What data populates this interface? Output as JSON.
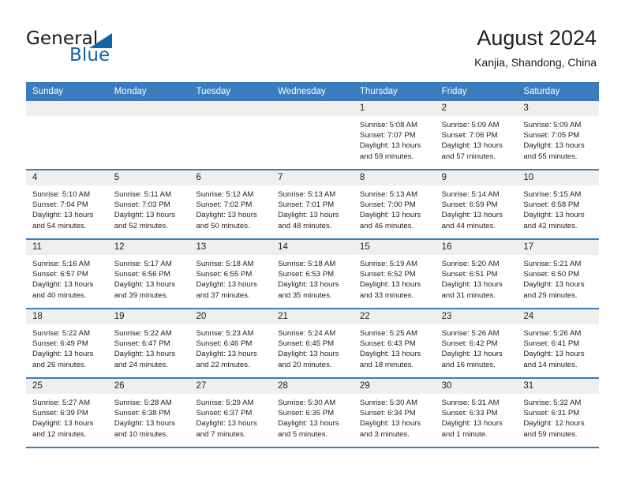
{
  "logo": {
    "general_text": "General",
    "blue_text": "Blue",
    "triangle_color": "#1464aa"
  },
  "header": {
    "title": "August 2024",
    "subtitle": "Kanjia, Shandong, China"
  },
  "theme": {
    "header_blue": "#3a7cbe",
    "day_band_gray": "#efefef",
    "text_dark": "#222222"
  },
  "weekdays": [
    "Sunday",
    "Monday",
    "Tuesday",
    "Wednesday",
    "Thursday",
    "Friday",
    "Saturday"
  ],
  "weeks": [
    {
      "days": [
        {
          "number": "",
          "sunrise": "",
          "sunset": "",
          "daylight_line1": "",
          "daylight_line2": "",
          "empty": true
        },
        {
          "number": "",
          "sunrise": "",
          "sunset": "",
          "daylight_line1": "",
          "daylight_line2": "",
          "empty": true
        },
        {
          "number": "",
          "sunrise": "",
          "sunset": "",
          "daylight_line1": "",
          "daylight_line2": "",
          "empty": true
        },
        {
          "number": "",
          "sunrise": "",
          "sunset": "",
          "daylight_line1": "",
          "daylight_line2": "",
          "empty": true
        },
        {
          "number": "1",
          "sunrise": "Sunrise: 5:08 AM",
          "sunset": "Sunset: 7:07 PM",
          "daylight_line1": "Daylight: 13 hours",
          "daylight_line2": "and 59 minutes.",
          "empty": false
        },
        {
          "number": "2",
          "sunrise": "Sunrise: 5:09 AM",
          "sunset": "Sunset: 7:06 PM",
          "daylight_line1": "Daylight: 13 hours",
          "daylight_line2": "and 57 minutes.",
          "empty": false
        },
        {
          "number": "3",
          "sunrise": "Sunrise: 5:09 AM",
          "sunset": "Sunset: 7:05 PM",
          "daylight_line1": "Daylight: 13 hours",
          "daylight_line2": "and 55 minutes.",
          "empty": false
        }
      ]
    },
    {
      "days": [
        {
          "number": "4",
          "sunrise": "Sunrise: 5:10 AM",
          "sunset": "Sunset: 7:04 PM",
          "daylight_line1": "Daylight: 13 hours",
          "daylight_line2": "and 54 minutes.",
          "empty": false
        },
        {
          "number": "5",
          "sunrise": "Sunrise: 5:11 AM",
          "sunset": "Sunset: 7:03 PM",
          "daylight_line1": "Daylight: 13 hours",
          "daylight_line2": "and 52 minutes.",
          "empty": false
        },
        {
          "number": "6",
          "sunrise": "Sunrise: 5:12 AM",
          "sunset": "Sunset: 7:02 PM",
          "daylight_line1": "Daylight: 13 hours",
          "daylight_line2": "and 50 minutes.",
          "empty": false
        },
        {
          "number": "7",
          "sunrise": "Sunrise: 5:13 AM",
          "sunset": "Sunset: 7:01 PM",
          "daylight_line1": "Daylight: 13 hours",
          "daylight_line2": "and 48 minutes.",
          "empty": false
        },
        {
          "number": "8",
          "sunrise": "Sunrise: 5:13 AM",
          "sunset": "Sunset: 7:00 PM",
          "daylight_line1": "Daylight: 13 hours",
          "daylight_line2": "and 46 minutes.",
          "empty": false
        },
        {
          "number": "9",
          "sunrise": "Sunrise: 5:14 AM",
          "sunset": "Sunset: 6:59 PM",
          "daylight_line1": "Daylight: 13 hours",
          "daylight_line2": "and 44 minutes.",
          "empty": false
        },
        {
          "number": "10",
          "sunrise": "Sunrise: 5:15 AM",
          "sunset": "Sunset: 6:58 PM",
          "daylight_line1": "Daylight: 13 hours",
          "daylight_line2": "and 42 minutes.",
          "empty": false
        }
      ]
    },
    {
      "days": [
        {
          "number": "11",
          "sunrise": "Sunrise: 5:16 AM",
          "sunset": "Sunset: 6:57 PM",
          "daylight_line1": "Daylight: 13 hours",
          "daylight_line2": "and 40 minutes.",
          "empty": false
        },
        {
          "number": "12",
          "sunrise": "Sunrise: 5:17 AM",
          "sunset": "Sunset: 6:56 PM",
          "daylight_line1": "Daylight: 13 hours",
          "daylight_line2": "and 39 minutes.",
          "empty": false
        },
        {
          "number": "13",
          "sunrise": "Sunrise: 5:18 AM",
          "sunset": "Sunset: 6:55 PM",
          "daylight_line1": "Daylight: 13 hours",
          "daylight_line2": "and 37 minutes.",
          "empty": false
        },
        {
          "number": "14",
          "sunrise": "Sunrise: 5:18 AM",
          "sunset": "Sunset: 6:53 PM",
          "daylight_line1": "Daylight: 13 hours",
          "daylight_line2": "and 35 minutes.",
          "empty": false
        },
        {
          "number": "15",
          "sunrise": "Sunrise: 5:19 AM",
          "sunset": "Sunset: 6:52 PM",
          "daylight_line1": "Daylight: 13 hours",
          "daylight_line2": "and 33 minutes.",
          "empty": false
        },
        {
          "number": "16",
          "sunrise": "Sunrise: 5:20 AM",
          "sunset": "Sunset: 6:51 PM",
          "daylight_line1": "Daylight: 13 hours",
          "daylight_line2": "and 31 minutes.",
          "empty": false
        },
        {
          "number": "17",
          "sunrise": "Sunrise: 5:21 AM",
          "sunset": "Sunset: 6:50 PM",
          "daylight_line1": "Daylight: 13 hours",
          "daylight_line2": "and 29 minutes.",
          "empty": false
        }
      ]
    },
    {
      "days": [
        {
          "number": "18",
          "sunrise": "Sunrise: 5:22 AM",
          "sunset": "Sunset: 6:49 PM",
          "daylight_line1": "Daylight: 13 hours",
          "daylight_line2": "and 26 minutes.",
          "empty": false
        },
        {
          "number": "19",
          "sunrise": "Sunrise: 5:22 AM",
          "sunset": "Sunset: 6:47 PM",
          "daylight_line1": "Daylight: 13 hours",
          "daylight_line2": "and 24 minutes.",
          "empty": false
        },
        {
          "number": "20",
          "sunrise": "Sunrise: 5:23 AM",
          "sunset": "Sunset: 6:46 PM",
          "daylight_line1": "Daylight: 13 hours",
          "daylight_line2": "and 22 minutes.",
          "empty": false
        },
        {
          "number": "21",
          "sunrise": "Sunrise: 5:24 AM",
          "sunset": "Sunset: 6:45 PM",
          "daylight_line1": "Daylight: 13 hours",
          "daylight_line2": "and 20 minutes.",
          "empty": false
        },
        {
          "number": "22",
          "sunrise": "Sunrise: 5:25 AM",
          "sunset": "Sunset: 6:43 PM",
          "daylight_line1": "Daylight: 13 hours",
          "daylight_line2": "and 18 minutes.",
          "empty": false
        },
        {
          "number": "23",
          "sunrise": "Sunrise: 5:26 AM",
          "sunset": "Sunset: 6:42 PM",
          "daylight_line1": "Daylight: 13 hours",
          "daylight_line2": "and 16 minutes.",
          "empty": false
        },
        {
          "number": "24",
          "sunrise": "Sunrise: 5:26 AM",
          "sunset": "Sunset: 6:41 PM",
          "daylight_line1": "Daylight: 13 hours",
          "daylight_line2": "and 14 minutes.",
          "empty": false
        }
      ]
    },
    {
      "days": [
        {
          "number": "25",
          "sunrise": "Sunrise: 5:27 AM",
          "sunset": "Sunset: 6:39 PM",
          "daylight_line1": "Daylight: 13 hours",
          "daylight_line2": "and 12 minutes.",
          "empty": false
        },
        {
          "number": "26",
          "sunrise": "Sunrise: 5:28 AM",
          "sunset": "Sunset: 6:38 PM",
          "daylight_line1": "Daylight: 13 hours",
          "daylight_line2": "and 10 minutes.",
          "empty": false
        },
        {
          "number": "27",
          "sunrise": "Sunrise: 5:29 AM",
          "sunset": "Sunset: 6:37 PM",
          "daylight_line1": "Daylight: 13 hours",
          "daylight_line2": "and 7 minutes.",
          "empty": false
        },
        {
          "number": "28",
          "sunrise": "Sunrise: 5:30 AM",
          "sunset": "Sunset: 6:35 PM",
          "daylight_line1": "Daylight: 13 hours",
          "daylight_line2": "and 5 minutes.",
          "empty": false
        },
        {
          "number": "29",
          "sunrise": "Sunrise: 5:30 AM",
          "sunset": "Sunset: 6:34 PM",
          "daylight_line1": "Daylight: 13 hours",
          "daylight_line2": "and 3 minutes.",
          "empty": false
        },
        {
          "number": "30",
          "sunrise": "Sunrise: 5:31 AM",
          "sunset": "Sunset: 6:33 PM",
          "daylight_line1": "Daylight: 13 hours",
          "daylight_line2": "and 1 minute.",
          "empty": false
        },
        {
          "number": "31",
          "sunrise": "Sunrise: 5:32 AM",
          "sunset": "Sunset: 6:31 PM",
          "daylight_line1": "Daylight: 12 hours",
          "daylight_line2": "and 59 minutes.",
          "empty": false
        }
      ]
    }
  ]
}
